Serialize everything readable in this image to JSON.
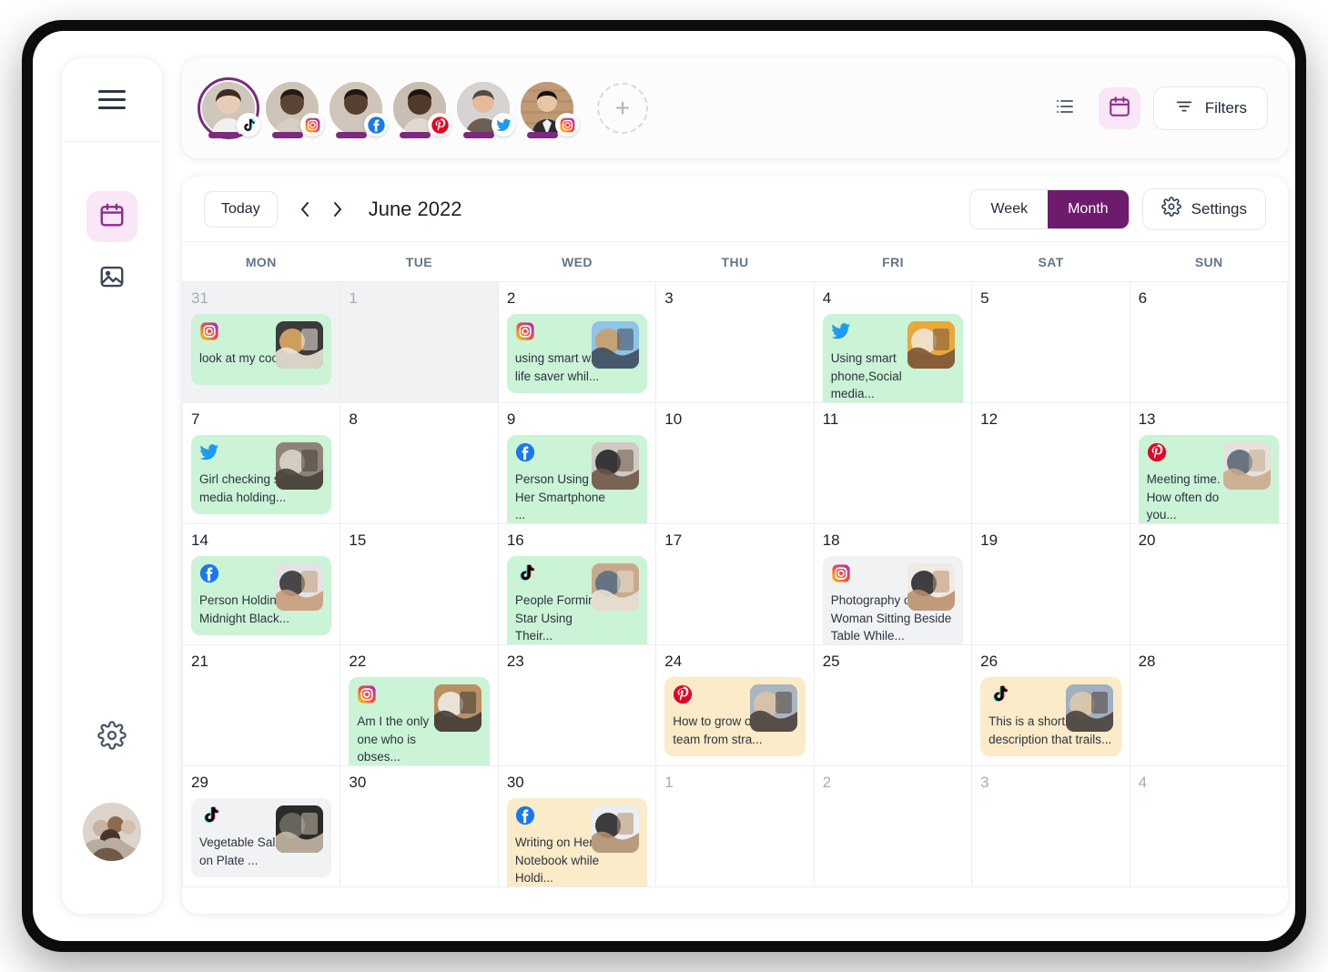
{
  "sidebar": {
    "menu_icon": "hamburger-menu-icon",
    "items": [
      {
        "icon": "calendar-icon",
        "active": true
      },
      {
        "icon": "image-icon",
        "active": false
      }
    ],
    "settings_icon": "gear-icon",
    "avatar": "team-group-avatar"
  },
  "topbar": {
    "profiles": [
      {
        "name": "profile-1",
        "platform": "tiktok",
        "selected": true
      },
      {
        "name": "profile-2",
        "platform": "instagram",
        "selected": false
      },
      {
        "name": "profile-3",
        "platform": "facebook",
        "selected": false
      },
      {
        "name": "profile-4",
        "platform": "pinterest",
        "selected": false
      },
      {
        "name": "profile-5",
        "platform": "twitter",
        "selected": false
      },
      {
        "name": "profile-6",
        "platform": "instagram",
        "selected": false
      }
    ],
    "add_label": "+",
    "list_view_icon": "list-view-icon",
    "calendar_view_icon": "calendar-view-icon",
    "filters_label": "Filters"
  },
  "calendar": {
    "today_label": "Today",
    "prev_label": "‹",
    "next_label": "›",
    "month_title": "June 2022",
    "view_week_label": "Week",
    "view_month_label": "Month",
    "active_view": "Month",
    "settings_label": "Settings",
    "weekdays": [
      "MON",
      "TUE",
      "WED",
      "THU",
      "FRI",
      "SAT",
      "SUN"
    ],
    "colors": {
      "accent_purple": "#6d1b6d",
      "accent_pink_bg": "#f9e6f7",
      "event_green": "#cbf3d6",
      "event_yellow": "#fcebc8",
      "event_grey": "#f1f2f4"
    },
    "days": [
      {
        "num": "31",
        "muted": true,
        "shaded": true,
        "event": {
          "platform": "instagram",
          "text": "look at my cootie",
          "color": "green",
          "thumb": "dog"
        }
      },
      {
        "num": "1",
        "muted": false,
        "shaded": true,
        "event": null
      },
      {
        "num": "2",
        "muted": false,
        "shaded": false,
        "event": {
          "platform": "instagram",
          "text": "using smart watch is life saver whil...",
          "color": "green",
          "thumb": "runner"
        }
      },
      {
        "num": "3",
        "muted": false,
        "shaded": false,
        "event": null
      },
      {
        "num": "4",
        "muted": false,
        "shaded": false,
        "event": {
          "platform": "twitter",
          "text": "Using smart phone,Social media...",
          "color": "green",
          "thumb": "reading"
        }
      },
      {
        "num": "5",
        "muted": false,
        "shaded": false,
        "event": null
      },
      {
        "num": "6",
        "muted": false,
        "shaded": false,
        "event": null
      },
      {
        "num": "7",
        "muted": false,
        "shaded": false,
        "event": {
          "platform": "twitter",
          "text": "Girl checking social media holding...",
          "color": "green",
          "thumb": "girl-laptop"
        }
      },
      {
        "num": "8",
        "muted": false,
        "shaded": false,
        "event": null
      },
      {
        "num": "9",
        "muted": false,
        "shaded": false,
        "event": {
          "platform": "facebook",
          "text": "Person Using Her Smartphone ...",
          "color": "green",
          "thumb": "hands-phone"
        }
      },
      {
        "num": "10",
        "muted": false,
        "shaded": false,
        "event": null
      },
      {
        "num": "11",
        "muted": false,
        "shaded": false,
        "event": null
      },
      {
        "num": "12",
        "muted": false,
        "shaded": false,
        "event": null
      },
      {
        "num": "13",
        "muted": false,
        "shaded": false,
        "event": {
          "platform": "pinterest",
          "text": "Meeting time. How often do you...",
          "color": "green",
          "thumb": "meeting"
        }
      },
      {
        "num": "14",
        "muted": false,
        "shaded": false,
        "event": {
          "platform": "facebook",
          "text": "Person Holding Midnight Black...",
          "color": "green",
          "thumb": "phone-bed"
        }
      },
      {
        "num": "15",
        "muted": false,
        "shaded": false,
        "event": null
      },
      {
        "num": "16",
        "muted": false,
        "shaded": false,
        "event": {
          "platform": "tiktok",
          "text": "People Forming Star Using Their...",
          "color": "green",
          "thumb": "people-desk"
        }
      },
      {
        "num": "17",
        "muted": false,
        "shaded": false,
        "event": null
      },
      {
        "num": "18",
        "muted": false,
        "shaded": false,
        "event": {
          "platform": "instagram",
          "text": "Photography of Woman Sitting Beside Table While...",
          "color": "grey",
          "thumb": "woman-desk"
        }
      },
      {
        "num": "19",
        "muted": false,
        "shaded": false,
        "event": null
      },
      {
        "num": "20",
        "muted": false,
        "shaded": false,
        "event": null
      },
      {
        "num": "21",
        "muted": false,
        "shaded": false,
        "event": null
      },
      {
        "num": "22",
        "muted": false,
        "shaded": false,
        "event": {
          "platform": "instagram",
          "text": "Am I the only one who is obses...",
          "color": "green",
          "thumb": "friends-phone"
        }
      },
      {
        "num": "23",
        "muted": false,
        "shaded": false,
        "event": null
      },
      {
        "num": "24",
        "muted": false,
        "shaded": false,
        "event": {
          "platform": "pinterest",
          "text": "How to grow our a team from stra...",
          "color": "yellow",
          "thumb": "woman-dog"
        }
      },
      {
        "num": "25",
        "muted": false,
        "shaded": false,
        "event": null
      },
      {
        "num": "26",
        "muted": false,
        "shaded": false,
        "event": {
          "platform": "tiktok",
          "text": "This is a short description that trails...",
          "color": "yellow",
          "thumb": "woman-dog2"
        }
      },
      {
        "num": "28",
        "muted": false,
        "shaded": false,
        "event": null
      },
      {
        "num": "29",
        "muted": false,
        "shaded": false,
        "event": {
          "platform": "tiktok",
          "text": "Vegetable Salad on Plate ...",
          "color": "grey",
          "thumb": "salad"
        }
      },
      {
        "num": "30",
        "muted": false,
        "shaded": false,
        "event": null
      },
      {
        "num": "30",
        "muted": false,
        "shaded": false,
        "event": {
          "platform": "facebook",
          "text": "Writing on Her Notebook while Holdi...",
          "color": "yellow",
          "thumb": "notebook"
        }
      },
      {
        "num": "1",
        "muted": true,
        "shaded": false,
        "event": null
      },
      {
        "num": "2",
        "muted": true,
        "shaded": false,
        "event": null
      },
      {
        "num": "3",
        "muted": true,
        "shaded": false,
        "event": null
      },
      {
        "num": "4",
        "muted": true,
        "shaded": false,
        "event": null
      }
    ]
  }
}
